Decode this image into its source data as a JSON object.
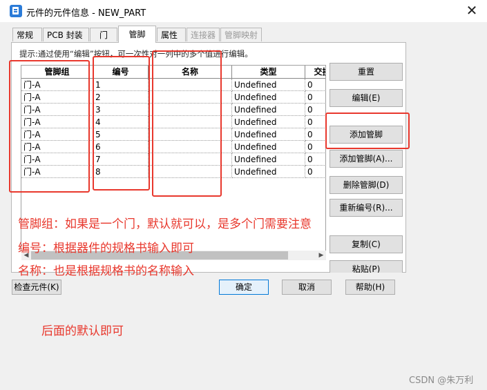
{
  "window": {
    "title": "元件的元件信息 - NEW_PART",
    "close_symbol": "✕"
  },
  "tabs": [
    {
      "label": "常规",
      "state": "normal"
    },
    {
      "label": "PCB 封装",
      "state": "normal"
    },
    {
      "label": "门",
      "state": "normal"
    },
    {
      "label": "管脚",
      "state": "active"
    },
    {
      "label": "属性",
      "state": "normal"
    },
    {
      "label": "连接器",
      "state": "disabled"
    },
    {
      "label": "管脚映射",
      "state": "disabled"
    }
  ],
  "hint": "提示:通过使用“编辑”按钮，可一次性对一列中的多个值进行编辑。",
  "table": {
    "columns": [
      "管脚组",
      "编号",
      "名称",
      "类型",
      "交换"
    ],
    "rows": [
      [
        "门-A",
        "1",
        "",
        "Undefined",
        "0"
      ],
      [
        "门-A",
        "2",
        "",
        "Undefined",
        "0"
      ],
      [
        "门-A",
        "3",
        "",
        "Undefined",
        "0"
      ],
      [
        "门-A",
        "4",
        "",
        "Undefined",
        "0"
      ],
      [
        "门-A",
        "5",
        "",
        "Undefined",
        "0"
      ],
      [
        "门-A",
        "6",
        "",
        "Undefined",
        "0"
      ],
      [
        "门-A",
        "7",
        "",
        "Undefined",
        "0"
      ],
      [
        "门-A",
        "8",
        "",
        "Undefined",
        "0"
      ]
    ]
  },
  "side_buttons": [
    "重置",
    "编辑(E)",
    "添加管脚",
    "添加管脚(A)...",
    "删除管脚(D)",
    "重新编号(R)...",
    "复制(C)",
    "粘贴(P)"
  ],
  "footer": {
    "check_button": "检查元件(K)",
    "ok_button": "确定",
    "cancel_button": "取消",
    "help_button": "帮助(H)"
  },
  "annotations": [
    "管脚组：如果是一个门，默认就可以，是多个门需要注意",
    "编号：根据器件的规格书输入即可",
    "名称：也是根据规格书的名称输入",
    "后面的默认即可"
  ],
  "watermark": "CSDN @朱万利",
  "colors": {
    "annotation": "#e8372c",
    "accent": "#0078d7"
  }
}
